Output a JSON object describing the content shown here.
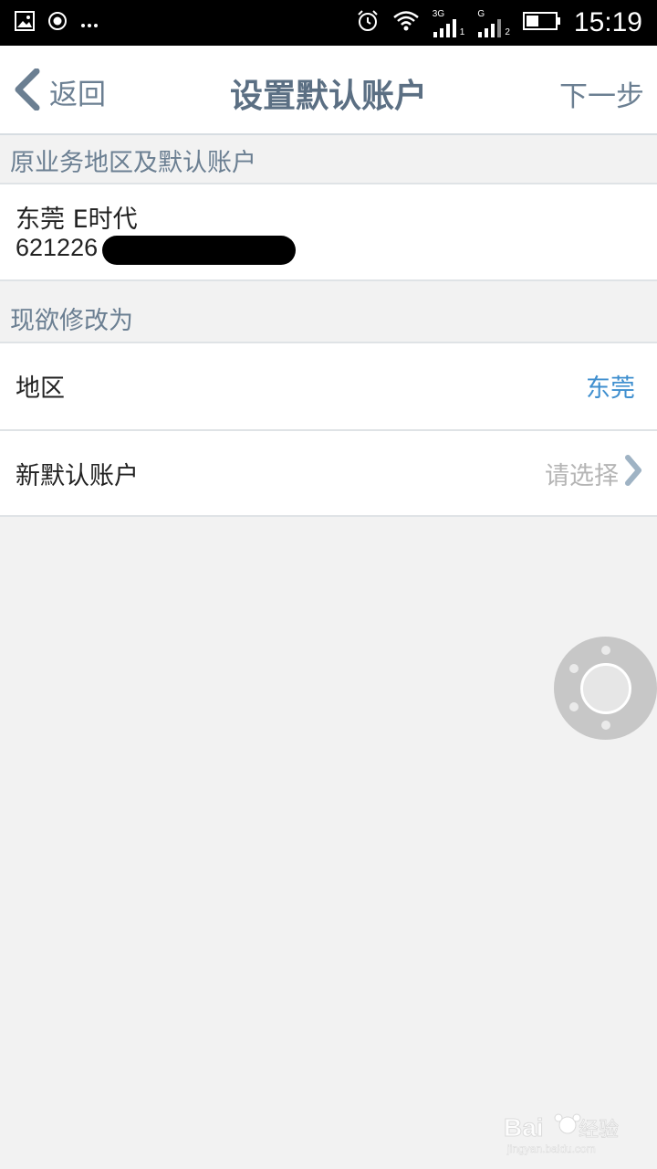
{
  "status_bar": {
    "time": "15:19",
    "net1": "3G",
    "net2": "G",
    "sim1": "1",
    "sim2": "2",
    "icons": [
      "image-icon",
      "record-icon",
      "more-icon",
      "alarm-icon",
      "wifi-icon",
      "signal-icon",
      "battery-icon"
    ]
  },
  "header": {
    "back_label": "返回",
    "title": "设置默认账户",
    "next_label": "下一步"
  },
  "original": {
    "section_title": "原业务地区及默认账户",
    "account_name": "东莞  E时代",
    "account_number_prefix": "621226"
  },
  "modify": {
    "section_title": "现欲修改为",
    "region_label": "地区",
    "region_value": "东莞",
    "account_label": "新默认账户",
    "account_placeholder": "请选择"
  },
  "colors": {
    "header_text": "#5b6f83",
    "accent_blue": "#3f8fcf",
    "placeholder_grey": "#b5b5b5",
    "background": "#f2f2f2"
  }
}
